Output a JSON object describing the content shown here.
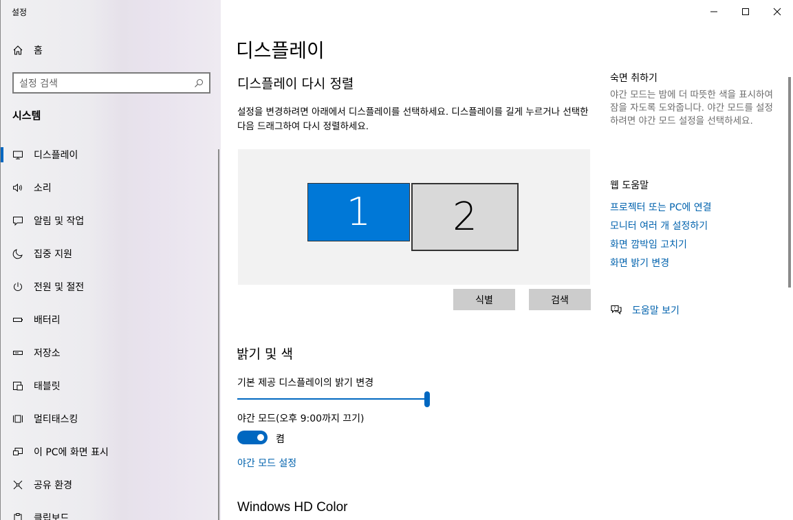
{
  "app": {
    "title": "설정"
  },
  "window_controls": {
    "minimize": "minimize-icon",
    "maximize": "maximize-icon",
    "close": "close-icon"
  },
  "sidebar": {
    "home_label": "홈",
    "search_placeholder": "설정 검색",
    "section_title": "시스템",
    "items": [
      {
        "label": "디스플레이",
        "icon": "monitor-icon",
        "active": true
      },
      {
        "label": "소리",
        "icon": "speaker-icon"
      },
      {
        "label": "알림 및 작업",
        "icon": "notification-icon"
      },
      {
        "label": "집중 지원",
        "icon": "moon-icon"
      },
      {
        "label": "전원 및 절전",
        "icon": "power-icon"
      },
      {
        "label": "배터리",
        "icon": "battery-icon"
      },
      {
        "label": "저장소",
        "icon": "storage-icon"
      },
      {
        "label": "태블릿",
        "icon": "tablet-icon"
      },
      {
        "label": "멀티태스킹",
        "icon": "multitasking-icon"
      },
      {
        "label": "이 PC에 화면 표시",
        "icon": "project-icon"
      },
      {
        "label": "공유 환경",
        "icon": "shared-icon"
      },
      {
        "label": "클립보드",
        "icon": "clipboard-icon"
      }
    ]
  },
  "main": {
    "title": "디스플레이",
    "rearrange_title": "디스플레이 다시 정렬",
    "rearrange_desc": "설정을 변경하려면 아래에서 디스플레이를 선택하세요. 디스플레이를 길게 누르거나 선택한 다음 드래그하여 다시 정렬하세요.",
    "monitors": [
      "1",
      "2"
    ],
    "identify_button": "식별",
    "detect_button": "검색",
    "brightness_title": "밝기 및 색",
    "brightness_label": "기본 제공 디스플레이의 밝기 변경",
    "brightness_value": 1.0,
    "night_light_label": "야간 모드(오후 9:00까지 끄기)",
    "night_light_state": "켬",
    "night_light_settings_link": "야간 모드 설정",
    "hd_color_title": "Windows HD Color"
  },
  "right_column": {
    "sleep_title": "숙면 취하기",
    "sleep_text": "야간 모드는 밤에 더 따뜻한 색을 표시하여 잠을 자도록 도와줍니다. 야간 모드를 설정하려면 야간 모드 설정을 선택하세요.",
    "help_title": "웹 도움말",
    "help_links": [
      "프로젝터 또는 PC에 연결",
      "모니터 여러 개 설정하기",
      "화면 깜박임 고치기",
      "화면 밝기 변경"
    ],
    "get_help": "도움말 보기"
  },
  "colors": {
    "accent": "#0067c0",
    "link": "#0062ad",
    "monitor_selected": "#0078d7"
  }
}
